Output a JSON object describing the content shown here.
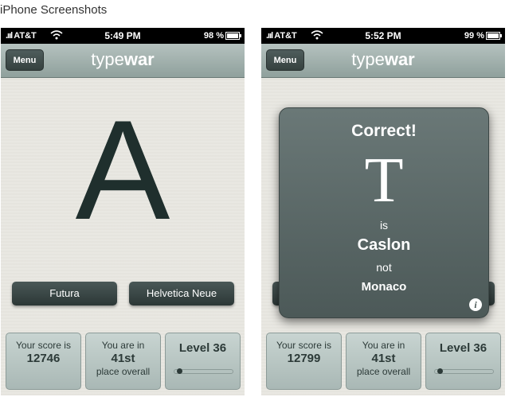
{
  "heading": "iPhone Screenshots",
  "screens": [
    {
      "status": {
        "carrier": "AT&T",
        "time": "5:49 PM",
        "battery_pct": "98 %",
        "battery_level": 0.98
      },
      "navbar": {
        "menu_label": "Menu",
        "logo_light": "type",
        "logo_bold": "war"
      },
      "letter": "A",
      "choices": [
        "Futura",
        "Helvetica Neue"
      ],
      "score": {
        "label": "Your score is",
        "value": "12746"
      },
      "rank": {
        "label": "You are in",
        "value": "41st",
        "suffix": "place overall"
      },
      "level": {
        "label": "Level 36",
        "progress": 0.05
      }
    },
    {
      "status": {
        "carrier": "AT&T",
        "time": "5:52 PM",
        "battery_pct": "99 %",
        "battery_level": 0.99
      },
      "navbar": {
        "menu_label": "Menu",
        "logo_light": "type",
        "logo_bold": "war"
      },
      "result": {
        "heading": "Correct!",
        "glyph": "T",
        "is_text": "is",
        "font": "Caslon",
        "not_text": "not",
        "wrong_font": "Monaco"
      },
      "score": {
        "label": "Your score is",
        "value": "12799"
      },
      "rank": {
        "label": "You are in",
        "value": "41st",
        "suffix": "place overall"
      },
      "level": {
        "label": "Level 36",
        "progress": 0.05
      }
    }
  ]
}
